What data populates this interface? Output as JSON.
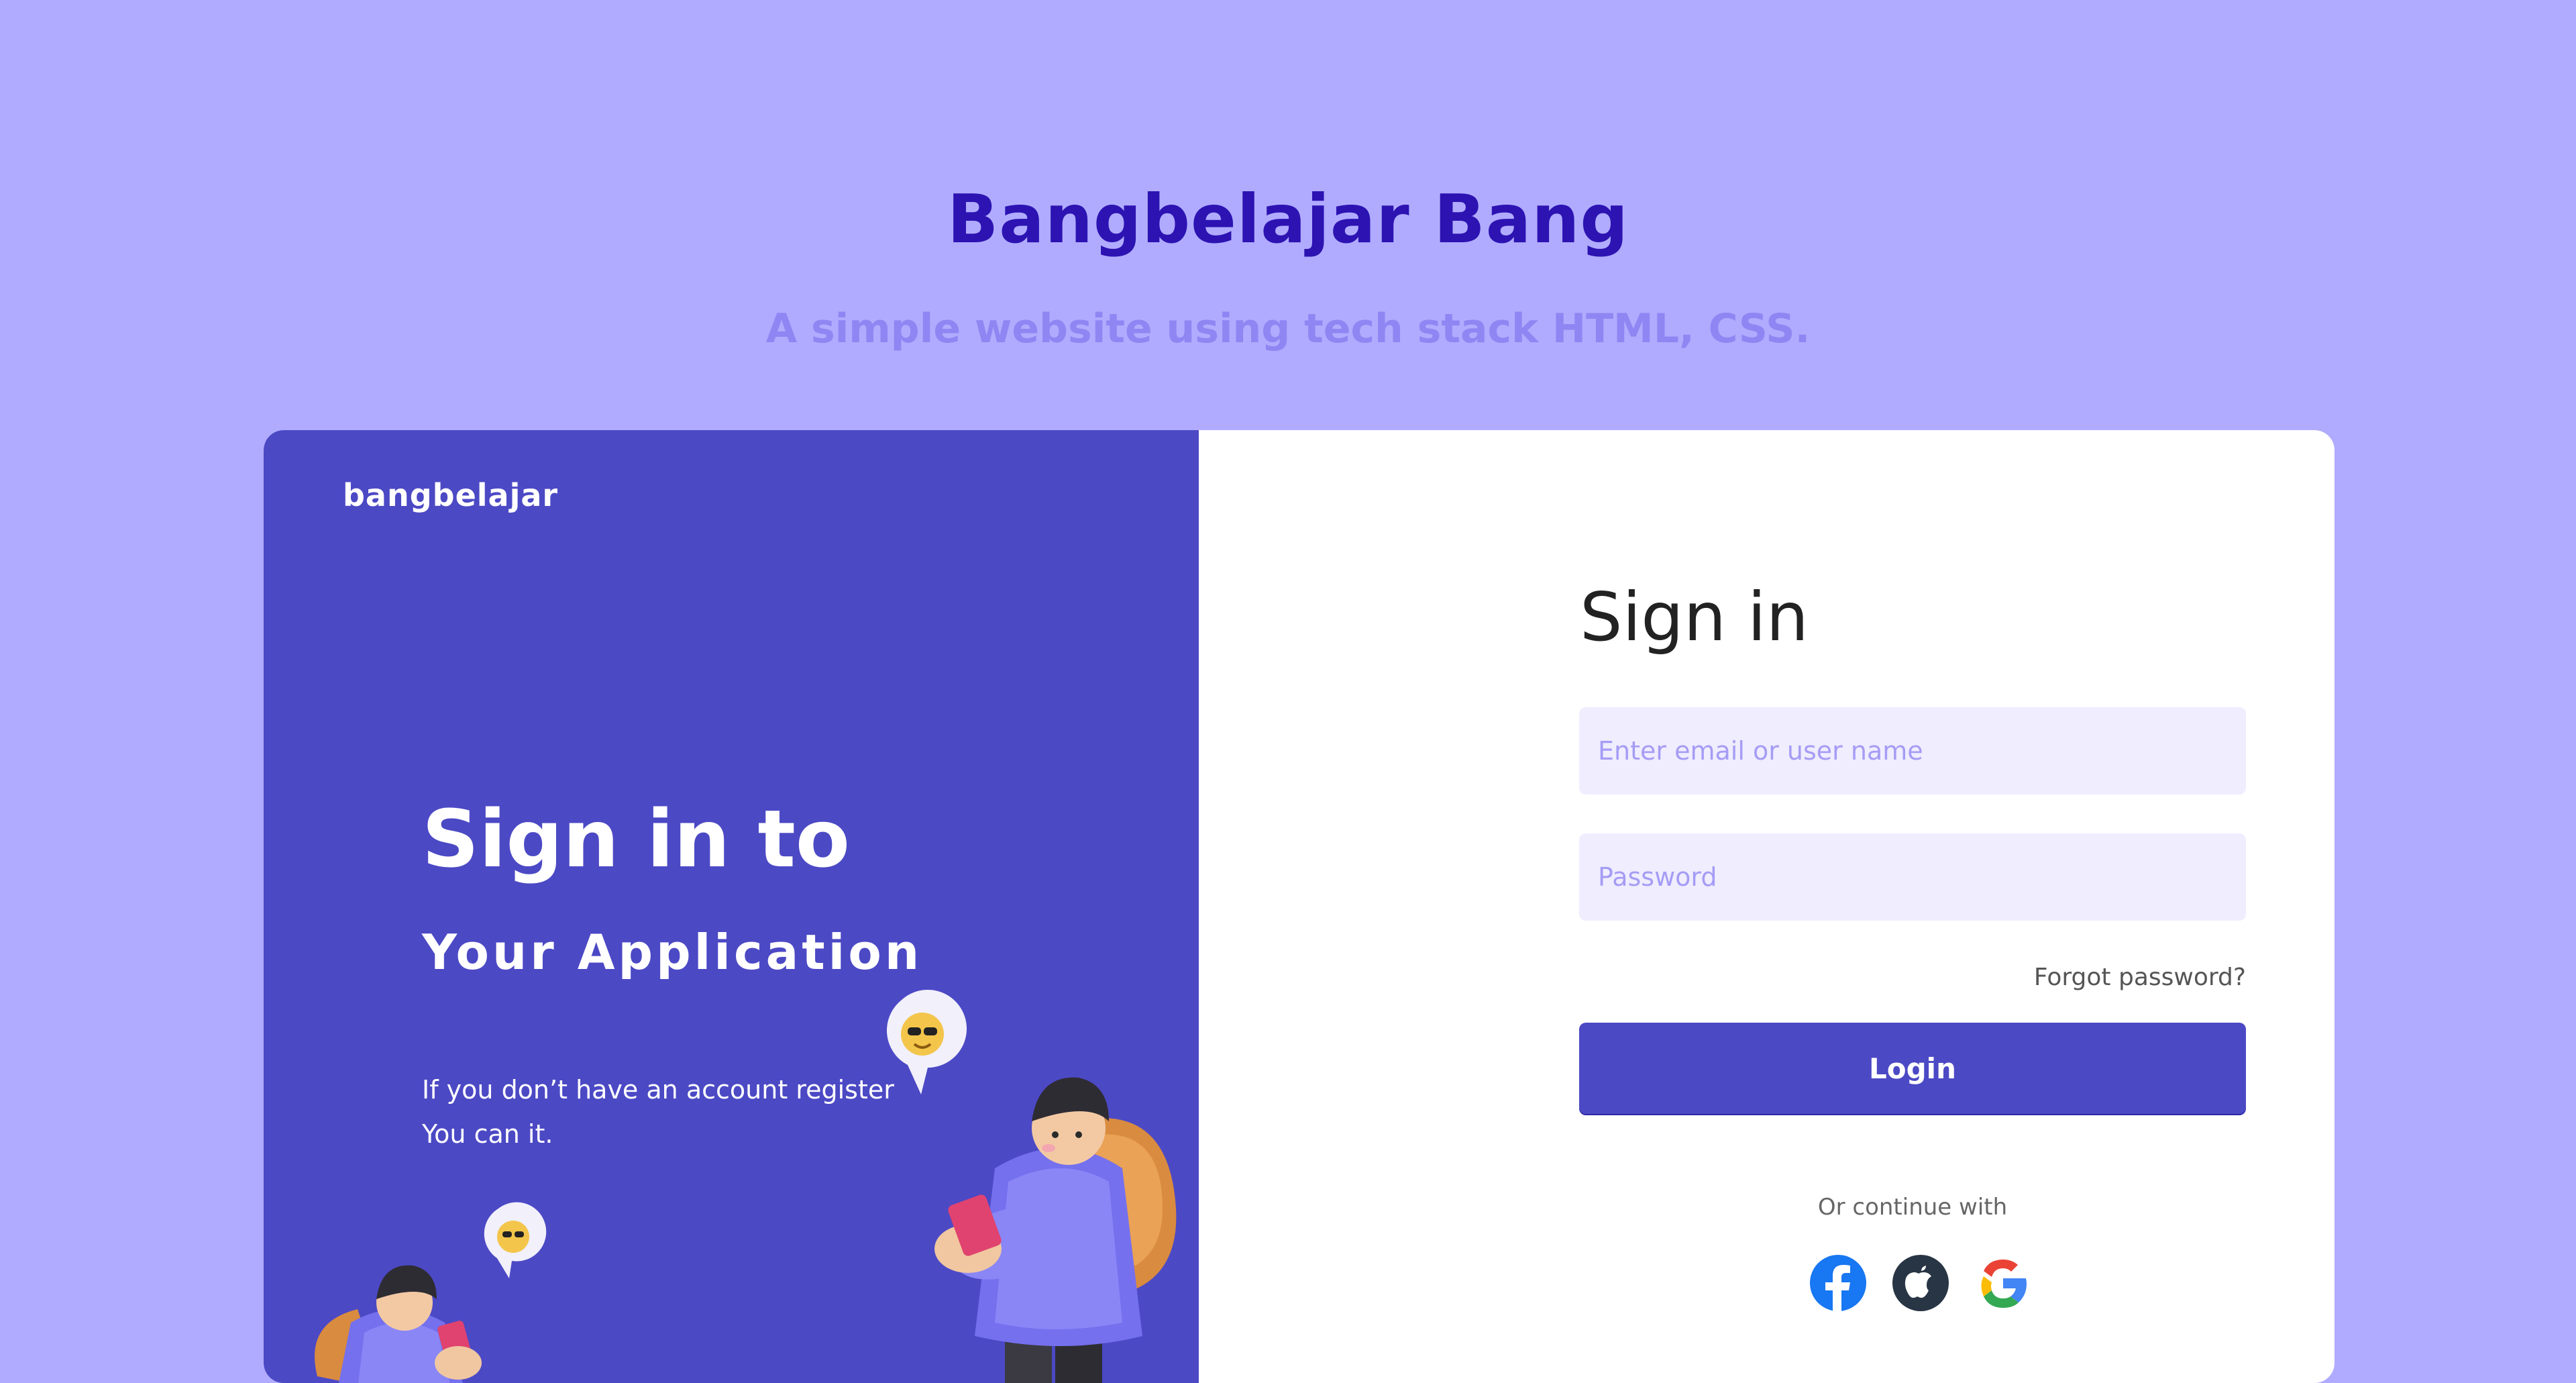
{
  "hero": {
    "title": "Bangbelajar Bang",
    "subtitle": "A simple website using tech stack HTML, CSS."
  },
  "left_panel": {
    "brand": "bangbelajar",
    "heading": "Sign in to",
    "subheading": "Your Application",
    "note_line1": "If you don’t have an account register",
    "note_line2": "You can it.",
    "background_color": "#4c49c5"
  },
  "form": {
    "title": "Sign in",
    "email_placeholder": "Enter email or user name",
    "password_placeholder": "Password",
    "forgot_label": "Forgot password?",
    "login_label": "Login",
    "or_continue": "Or continue with"
  },
  "social": [
    "facebook-icon",
    "apple-icon",
    "google-icon"
  ],
  "colors": {
    "page_background": "#b0abfe",
    "title": "#2c13b2",
    "subtitle": "#8f86f3",
    "accent": "#4c49c5",
    "input_background": "#efedfe"
  }
}
